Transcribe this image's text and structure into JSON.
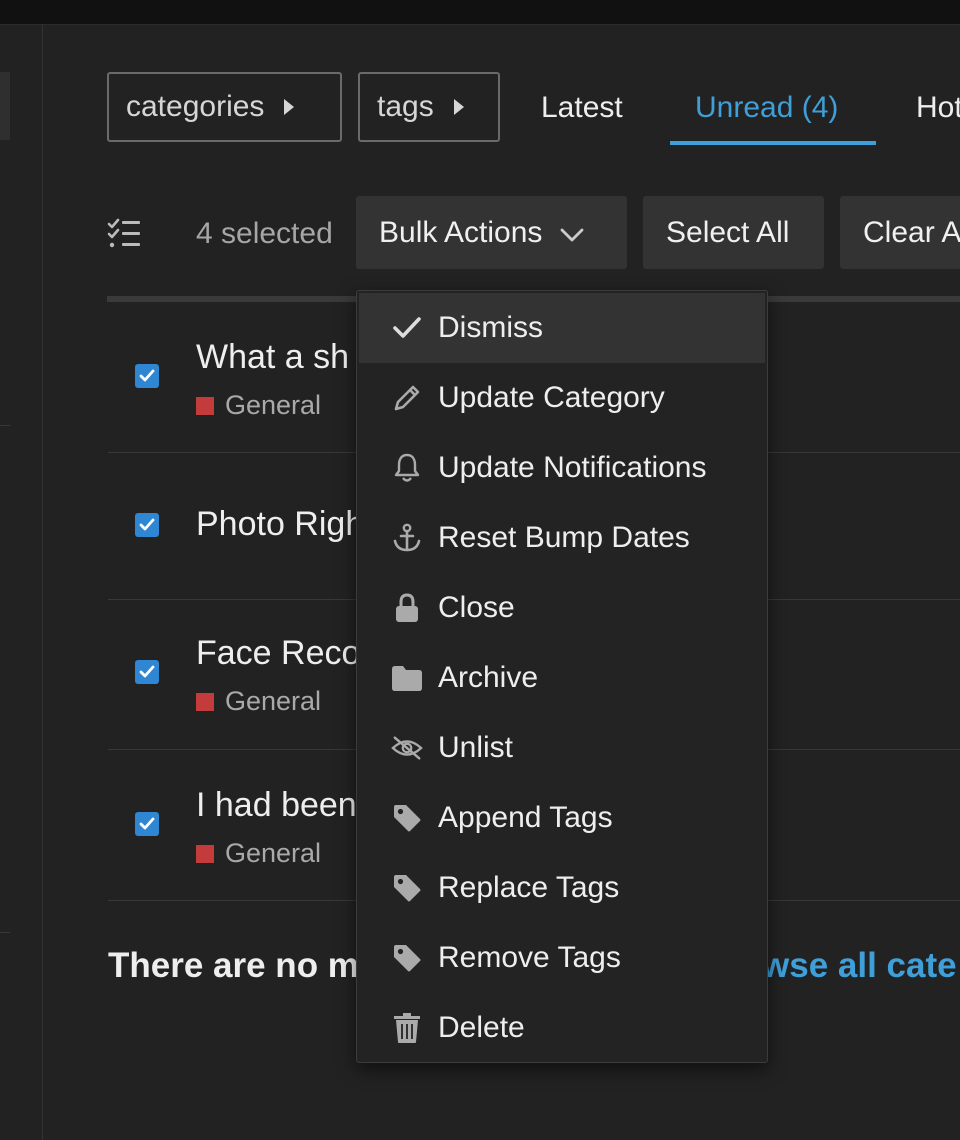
{
  "nav": {
    "categories_label": "categories",
    "tags_label": "tags",
    "tabs": [
      {
        "label": "Latest",
        "active": false
      },
      {
        "label": "Unread (4)",
        "active": true
      },
      {
        "label": "Hot",
        "active": false
      }
    ]
  },
  "bulk_bar": {
    "selected_text": "4 selected",
    "bulk_actions_label": "Bulk Actions",
    "select_all_label": "Select All",
    "clear_all_label": "Clear All"
  },
  "topics": [
    {
      "title": "What a sh",
      "category": "General",
      "checked": true
    },
    {
      "title": "Photo Righ",
      "category": "",
      "checked": true
    },
    {
      "title": "Face Reco",
      "category": "General",
      "checked": true
    },
    {
      "title": "I had been",
      "category": "General",
      "checked": true
    }
  ],
  "footer": {
    "message": "There are no m",
    "link": "wse all cate"
  },
  "bulk_menu": {
    "items": [
      {
        "label": "Dismiss",
        "icon": "check-icon"
      },
      {
        "label": "Update Category",
        "icon": "pencil-icon"
      },
      {
        "label": "Update Notifications",
        "icon": "bell-icon"
      },
      {
        "label": "Reset Bump Dates",
        "icon": "anchor-icon"
      },
      {
        "label": "Close",
        "icon": "lock-icon"
      },
      {
        "label": "Archive",
        "icon": "folder-icon"
      },
      {
        "label": "Unlist",
        "icon": "eye-slash-icon"
      },
      {
        "label": "Append Tags",
        "icon": "tag-icon"
      },
      {
        "label": "Replace Tags",
        "icon": "tag-icon"
      },
      {
        "label": "Remove Tags",
        "icon": "tag-icon"
      },
      {
        "label": "Delete",
        "icon": "trash-icon"
      }
    ]
  },
  "colors": {
    "background": "#222222",
    "accent": "#3f9fd9",
    "category_general": "#c33b3b",
    "checkbox": "#2f86d2"
  }
}
